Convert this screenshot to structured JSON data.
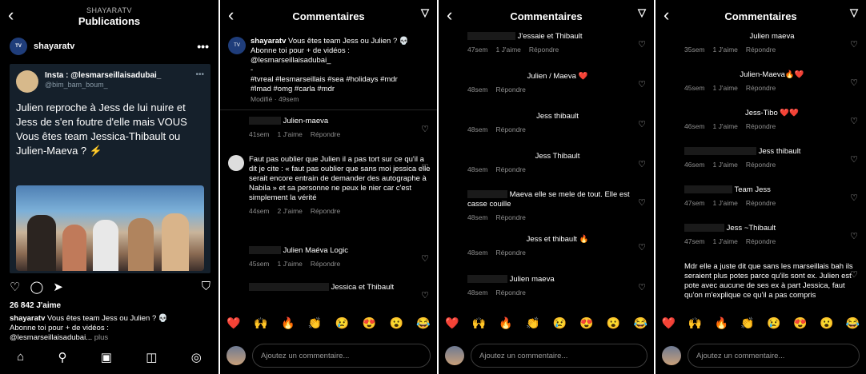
{
  "post": {
    "header_account": "SHAYARATV",
    "header_title": "Publications",
    "account": "shayaratv",
    "tweet": {
      "name": "Insta : @lesmarseillaisadubai_",
      "handle": "@bim_bam_boum_",
      "text": "Julien reproche à Jess de lui nuire et Jess de s'en foutre d'elle mais VOUS Vous êtes team Jessica-Thibault ou Julien-Maeva ? ⚡"
    },
    "likes": "26 842 J'aime",
    "caption_user": "shayaratv",
    "caption_line1": " Vous êtes team Jess ou Julien ? 💀",
    "caption_line2": "Abonne toi pour + de vidéos :",
    "caption_line3": "@lesmarseillaisadubai...",
    "caption_more": "plus"
  },
  "comments_title": "Commentaires",
  "input_placeholder": "Ajoutez un commentaire...",
  "emoji_bar": [
    "❤️",
    "🙌",
    "🔥",
    "👏",
    "😢",
    "😍",
    "😮",
    "😂"
  ],
  "panel2": {
    "caption": {
      "user": "shayaratv",
      "text1": " Vous êtes team Jess ou Julien ? 💀",
      "text2": "Abonne toi pour + de vidéos :",
      "text3": "@lesmarseillaisadubai_",
      "text4": "-",
      "text5": "#tvreal #lesmarseillais #sea #holidays #mdr",
      "text6": "#lmad #omg #carla #mdr",
      "meta": "Modifié · 49sem"
    },
    "comments": [
      {
        "text": "Julien-maeva",
        "time": "41sem",
        "likes": "1 J'aime",
        "reply": "Répondre"
      },
      {
        "text": "Faut pas oublier que Julien il a pas tort sur ce qu'il a dit je cite : « faut pas oublier que sans moi jessica elle serait encore entrain de demander des autographe à Nabila » et sa personne ne peux le nier car c'est simplement la vérité",
        "time": "44sem",
        "likes": "2 J'aime",
        "reply": "Répondre"
      },
      {
        "text": "Julien Maéva Logic",
        "time": "45sem",
        "likes": "1 J'aime",
        "reply": "Répondre"
      },
      {
        "text": "Jessica et Thibault",
        "time": "",
        "likes": "",
        "reply": ""
      }
    ]
  },
  "panel3": {
    "comments": [
      {
        "text": "J'essaie et Thibault",
        "time": "47sem",
        "likes": "1 J'aime",
        "reply": "Répondre"
      },
      {
        "text": "Julien / Maeva ❤️",
        "time": "48sem",
        "likes": "",
        "reply": "Répondre"
      },
      {
        "text": "Jess thibault",
        "time": "48sem",
        "likes": "",
        "reply": "Répondre"
      },
      {
        "text": "Jess Thibault",
        "time": "48sem",
        "likes": "",
        "reply": "Répondre"
      },
      {
        "text": "Maeva elle se mele de tout. Elle est casse couille",
        "time": "48sem",
        "likes": "",
        "reply": "Répondre"
      },
      {
        "text": "Jess et thibault 🔥",
        "time": "48sem",
        "likes": "",
        "reply": "Répondre"
      },
      {
        "text": "Julien maeva",
        "time": "48sem",
        "likes": "",
        "reply": "Répondre"
      }
    ]
  },
  "panel4": {
    "comments": [
      {
        "text": "Julien maeva",
        "time": "35sem",
        "likes": "1 J'aime",
        "reply": "Répondre"
      },
      {
        "text": "Julien-Maeva🔥❤️",
        "time": "45sem",
        "likes": "1 J'aime",
        "reply": "Répondre"
      },
      {
        "text": "Jess-Tibo ❤️❤️",
        "time": "46sem",
        "likes": "1 J'aime",
        "reply": "Répondre"
      },
      {
        "text": "Jess thibault",
        "time": "46sem",
        "likes": "1 J'aime",
        "reply": "Répondre"
      },
      {
        "text": "Team Jess",
        "time": "47sem",
        "likes": "1 J'aime",
        "reply": "Répondre"
      },
      {
        "text": "Jess ~Thibault",
        "time": "47sem",
        "likes": "1 J'aime",
        "reply": "Répondre"
      },
      {
        "text": "Mdr elle a juste dit que sans les marseillais bah ils seraient plus potes parce qu'ils sont ex. Julien est pote avec aucune de ses ex à part Jessica, faut qu'on m'explique ce qu'il a pas compris",
        "time": "",
        "likes": "",
        "reply": ""
      }
    ]
  }
}
